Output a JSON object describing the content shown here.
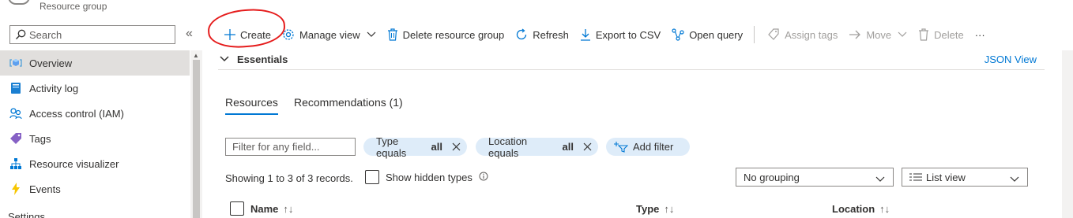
{
  "header": {
    "subtitle": "Resource group"
  },
  "sidebar": {
    "search": {
      "placeholder": "Search",
      "value": ""
    },
    "collapse_glyph": "«",
    "items": [
      {
        "label": "Overview",
        "icon": "overview-cube-icon",
        "active": true
      },
      {
        "label": "Activity log",
        "icon": "activity-log-icon"
      },
      {
        "label": "Access control (IAM)",
        "icon": "people-icon"
      },
      {
        "label": "Tags",
        "icon": "tag-icon"
      },
      {
        "label": "Resource visualizer",
        "icon": "hierarchy-icon"
      },
      {
        "label": "Events",
        "icon": "lightning-icon"
      }
    ],
    "section_label": "Settings"
  },
  "toolbar": {
    "create": "Create",
    "manage_view": "Manage view",
    "delete_rg": "Delete resource group",
    "refresh": "Refresh",
    "export_csv": "Export to CSV",
    "open_query": "Open query",
    "assign_tags": "Assign tags",
    "move": "Move",
    "delete": "Delete",
    "more": "···"
  },
  "essentials": {
    "label": "Essentials",
    "json_view": "JSON View"
  },
  "tabs": {
    "resources": "Resources",
    "recommendations": "Recommendations (1)"
  },
  "filters": {
    "input_placeholder": "Filter for any field...",
    "type_pill": {
      "label": "Type equals",
      "value": "all"
    },
    "location_pill": {
      "label": "Location equals",
      "value": "all"
    },
    "add_filter": "Add filter"
  },
  "records": {
    "text": "Showing 1 to 3 of 3 records.",
    "show_hidden": "Show hidden types"
  },
  "grouping": {
    "selected": "No grouping"
  },
  "view": {
    "selected": "List view"
  },
  "table": {
    "columns": {
      "name": "Name",
      "type": "Type",
      "location": "Location"
    }
  },
  "colors": {
    "accent": "#0078d4",
    "annotation": "#e51c1c",
    "pill_bg": "#deecf9"
  }
}
